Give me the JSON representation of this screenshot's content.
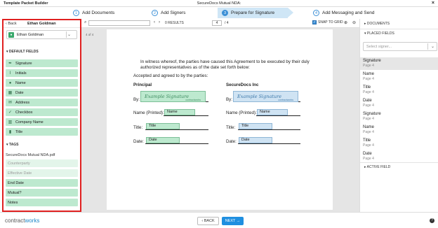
{
  "app_title": "Template Packet Builder",
  "document_title": "SecureDocs Mutual NDA:",
  "close_glyph": "×",
  "steps": [
    {
      "num": "1",
      "label": "Add Documents"
    },
    {
      "num": "2",
      "label": "Add Signers"
    },
    {
      "num": "3",
      "label": "Prepare for Signature"
    },
    {
      "num": "4",
      "label": "Add Messaging and Send"
    }
  ],
  "left_panel": {
    "back_label": "Back",
    "current_signer": "Ethan Goldman",
    "signer_select_value": "Ethan Goldman",
    "default_fields_heading": "DEFAULT FIELDS",
    "fields": [
      {
        "label": "Signature",
        "icon": "pen-icon"
      },
      {
        "label": "Initials",
        "icon": "initials-icon"
      },
      {
        "label": "Name",
        "icon": "person-icon"
      },
      {
        "label": "Date",
        "icon": "calendar-icon"
      },
      {
        "label": "Address",
        "icon": "envelope-icon"
      },
      {
        "label": "Checkbox",
        "icon": "check-icon"
      },
      {
        "label": "Company Name",
        "icon": "building-icon"
      },
      {
        "label": "Title",
        "icon": "bookmark-icon"
      }
    ],
    "tags_heading": "TAGS",
    "tags_document": "SecureDocs Mutual NDA.pdf",
    "tags": [
      "Counterparty",
      "Effective Date",
      "End Date",
      "Mutual?",
      "Notes"
    ]
  },
  "toolbar": {
    "results": "0 RESULTS",
    "page_current": "4",
    "page_total": "/ 4",
    "snap_label": "SNAP TO GRID"
  },
  "viewer": {
    "page_label": "4 of 4",
    "witness_line1": "In witness whereof, the parties have caused this Agreement to be executed by their duly",
    "witness_line2": "authorized representatives as of the date set forth below:",
    "accepted": "Accepted and agreed to by the parties:",
    "principal_heading": "Principal",
    "securedocs_heading": "SecureDocs Inc",
    "by_label": "By:",
    "name_printed_label": "Name (Printed):",
    "title_label": "Title:",
    "date_label": "Date:",
    "sig_placeholder": "Example Signature",
    "sig_brand": "contractworks",
    "name_box": "Name",
    "title_box": "Title",
    "date_box": "Date"
  },
  "right_panel": {
    "documents_heading": "DOCUMENTS",
    "placed_fields_heading": "PLACED FIELDS",
    "select_signer_placeholder": "Select signer...",
    "placed_fields": [
      {
        "name": "Signature",
        "page": "Page 4"
      },
      {
        "name": "Name",
        "page": "Page 4"
      },
      {
        "name": "Title",
        "page": "Page 4"
      },
      {
        "name": "Date",
        "page": "Page 4"
      },
      {
        "name": "Signature",
        "page": "Page 4"
      },
      {
        "name": "Name",
        "page": "Page 4"
      },
      {
        "name": "Title",
        "page": "Page 4"
      },
      {
        "name": "Date",
        "page": "Page 4"
      }
    ],
    "active_field_heading": "ACTIVE FIELD"
  },
  "footer": {
    "logo_contract": "contract",
    "logo_works": "works",
    "back_label": "‹  BACK",
    "next_label": "NEXT  →"
  },
  "colors": {
    "accent": "#1f8fe0",
    "signer_green": "#bde9cf",
    "counterparty_blue": "#cfe3f3",
    "highlight_border": "#e02020"
  }
}
